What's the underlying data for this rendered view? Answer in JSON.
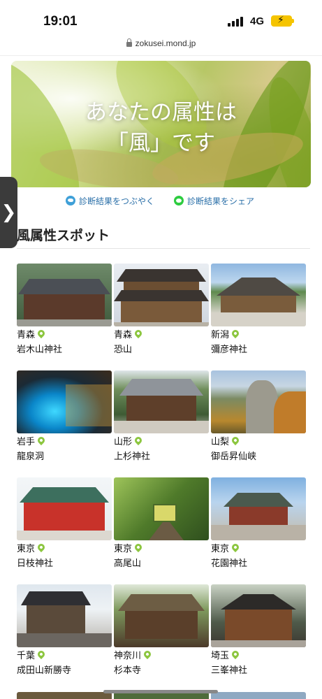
{
  "status_bar": {
    "time": "19:01",
    "network": "4G",
    "battery_icon": "battery-charging-icon",
    "signal_icon": "signal-bars-icon"
  },
  "browser": {
    "url": "zokusei.mond.jp",
    "lock_icon": "lock-icon"
  },
  "hero": {
    "title_line1": "あなたの属性は",
    "title_line2": "「風」です"
  },
  "side_tab": {
    "label": "❯"
  },
  "share": {
    "twitter_label": "診断結果をつぶやく",
    "line_label": "診断結果をシェア"
  },
  "section": {
    "title": "風属性スポット"
  },
  "spots": [
    {
      "pref": "青森",
      "name": "岩木山神社"
    },
    {
      "pref": "青森",
      "name": "恐山"
    },
    {
      "pref": "新潟",
      "name": "彌彦神社"
    },
    {
      "pref": "岩手",
      "name": "龍泉洞"
    },
    {
      "pref": "山形",
      "name": "上杉神社"
    },
    {
      "pref": "山梨",
      "name": "御岳昇仙峡"
    },
    {
      "pref": "東京",
      "name": "日枝神社"
    },
    {
      "pref": "東京",
      "name": "高尾山"
    },
    {
      "pref": "東京",
      "name": "花園神社"
    },
    {
      "pref": "千葉",
      "name": "成田山新勝寺"
    },
    {
      "pref": "神奈川",
      "name": "杉本寺"
    },
    {
      "pref": "埼玉",
      "name": "三峯神社"
    }
  ],
  "colors": {
    "link": "#2a6fa8",
    "pin": "#8cc63f",
    "side_tab": "#3b3b3b"
  }
}
